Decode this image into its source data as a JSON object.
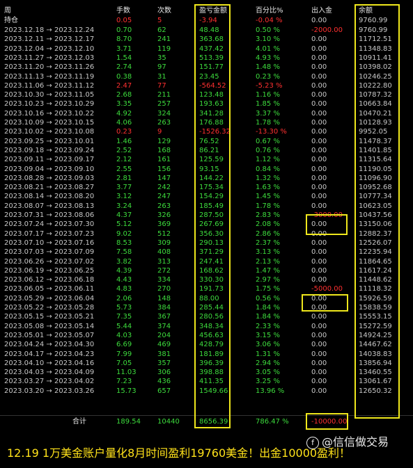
{
  "header": {
    "period": "周",
    "lots": "手数",
    "trades": "次数",
    "pnl": "盈亏金额",
    "pct": "百分比%",
    "flow": "出入金",
    "balance": "余额"
  },
  "open_row": {
    "period": "持仓",
    "lots": "0.05",
    "trades": "5",
    "pnl": "-3.94",
    "pct": "-0.04 %",
    "flow": "0.00",
    "balance": "9760.99"
  },
  "rows": [
    {
      "period": "2023.12.18 → 2023.12.24",
      "lots": "0.70",
      "trades": "62",
      "pnl": "48.48",
      "pct": "0.50 %",
      "flow": "-2000.00",
      "balance": "9760.99"
    },
    {
      "period": "2023.12.11 → 2023.12.17",
      "lots": "8.70",
      "trades": "241",
      "pnl": "363.68",
      "pct": "3.10 %",
      "flow": "0.00",
      "balance": "11712.51"
    },
    {
      "period": "2023.12.04 → 2023.12.10",
      "lots": "3.71",
      "trades": "119",
      "pnl": "437.42",
      "pct": "4.01 %",
      "flow": "0.00",
      "balance": "11348.83"
    },
    {
      "period": "2023.11.27 → 2023.12.03",
      "lots": "1.54",
      "trades": "35",
      "pnl": "513.39",
      "pct": "4.93 %",
      "flow": "0.00",
      "balance": "10911.41"
    },
    {
      "period": "2023.11.20 → 2023.11.26",
      "lots": "2.74",
      "trades": "97",
      "pnl": "151.77",
      "pct": "1.48 %",
      "flow": "0.00",
      "balance": "10398.02"
    },
    {
      "period": "2023.11.13 → 2023.11.19",
      "lots": "0.38",
      "trades": "31",
      "pnl": "23.45",
      "pct": "0.23 %",
      "flow": "0.00",
      "balance": "10246.25"
    },
    {
      "period": "2023.11.06 → 2023.11.12",
      "lots": "2.47",
      "trades": "77",
      "pnl": "-564.52",
      "pct": "-5.23 %",
      "flow": "0.00",
      "balance": "10222.80"
    },
    {
      "period": "2023.10.30 → 2023.11.05",
      "lots": "2.68",
      "trades": "211",
      "pnl": "123.48",
      "pct": "1.16 %",
      "flow": "0.00",
      "balance": "10787.32"
    },
    {
      "period": "2023.10.23 → 2023.10.29",
      "lots": "3.35",
      "trades": "257",
      "pnl": "193.63",
      "pct": "1.85 %",
      "flow": "0.00",
      "balance": "10663.84"
    },
    {
      "period": "2023.10.16 → 2023.10.22",
      "lots": "4.92",
      "trades": "324",
      "pnl": "341.28",
      "pct": "3.37 %",
      "flow": "0.00",
      "balance": "10470.21"
    },
    {
      "period": "2023.10.09 → 2023.10.15",
      "lots": "4.06",
      "trades": "263",
      "pnl": "176.88",
      "pct": "1.78 %",
      "flow": "0.00",
      "balance": "10128.93"
    },
    {
      "period": "2023.10.02 → 2023.10.08",
      "lots": "0.23",
      "trades": "9",
      "pnl": "-1526.32",
      "pct": "-13.30 %",
      "flow": "0.00",
      "balance": "9952.05"
    },
    {
      "period": "2023.09.25 → 2023.10.01",
      "lots": "1.46",
      "trades": "129",
      "pnl": "76.52",
      "pct": "0.67 %",
      "flow": "0.00",
      "balance": "11478.37"
    },
    {
      "period": "2023.09.18 → 2023.09.24",
      "lots": "2.52",
      "trades": "168",
      "pnl": "86.21",
      "pct": "0.76 %",
      "flow": "0.00",
      "balance": "11401.85"
    },
    {
      "period": "2023.09.11 → 2023.09.17",
      "lots": "2.12",
      "trades": "161",
      "pnl": "125.59",
      "pct": "1.12 %",
      "flow": "0.00",
      "balance": "11315.64"
    },
    {
      "period": "2023.09.04 → 2023.09.10",
      "lots": "2.55",
      "trades": "156",
      "pnl": "93.15",
      "pct": "0.84 %",
      "flow": "0.00",
      "balance": "11190.05"
    },
    {
      "period": "2023.08.28 → 2023.09.03",
      "lots": "2.81",
      "trades": "147",
      "pnl": "144.22",
      "pct": "1.32 %",
      "flow": "0.00",
      "balance": "11096.90"
    },
    {
      "period": "2023.08.21 → 2023.08.27",
      "lots": "3.77",
      "trades": "242",
      "pnl": "175.34",
      "pct": "1.63 %",
      "flow": "0.00",
      "balance": "10952.68"
    },
    {
      "period": "2023.08.14 → 2023.08.20",
      "lots": "3.12",
      "trades": "247",
      "pnl": "154.29",
      "pct": "1.45 %",
      "flow": "0.00",
      "balance": "10777.34"
    },
    {
      "period": "2023.08.07 → 2023.08.13",
      "lots": "3.24",
      "trades": "263",
      "pnl": "185.49",
      "pct": "1.78 %",
      "flow": "0.00",
      "balance": "10623.05"
    },
    {
      "period": "2023.07.31 → 2023.08.06",
      "lots": "4.37",
      "trades": "326",
      "pnl": "287.50",
      "pct": "2.83 %",
      "flow": "-3000.00",
      "balance": "10437.56"
    },
    {
      "period": "2023.07.24 → 2023.07.30",
      "lots": "5.12",
      "trades": "369",
      "pnl": "267.69",
      "pct": "2.08 %",
      "flow": "0.00",
      "balance": "13150.06"
    },
    {
      "period": "2023.07.17 → 2023.07.23",
      "lots": "9.02",
      "trades": "512",
      "pnl": "356.30",
      "pct": "2.86 %",
      "flow": "0.00",
      "balance": "12882.37"
    },
    {
      "period": "2023.07.10 → 2023.07.16",
      "lots": "8.53",
      "trades": "309",
      "pnl": "290.13",
      "pct": "2.37 %",
      "flow": "0.00",
      "balance": "12526.07"
    },
    {
      "period": "2023.07.03 → 2023.07.09",
      "lots": "7.58",
      "trades": "408",
      "pnl": "371.29",
      "pct": "3.13 %",
      "flow": "0.00",
      "balance": "12235.94"
    },
    {
      "period": "2023.06.26 → 2023.07.02",
      "lots": "3.82",
      "trades": "313",
      "pnl": "247.41",
      "pct": "2.13 %",
      "flow": "0.00",
      "balance": "11864.65"
    },
    {
      "period": "2023.06.19 → 2023.06.25",
      "lots": "4.39",
      "trades": "272",
      "pnl": "168.62",
      "pct": "1.47 %",
      "flow": "0.00",
      "balance": "11617.24"
    },
    {
      "period": "2023.06.12 → 2023.06.18",
      "lots": "4.43",
      "trades": "334",
      "pnl": "330.30",
      "pct": "2.97 %",
      "flow": "0.00",
      "balance": "11448.62"
    },
    {
      "period": "2023.06.05 → 2023.06.11",
      "lots": "4.83",
      "trades": "270",
      "pnl": "191.73",
      "pct": "1.75 %",
      "flow": "-5000.00",
      "balance": "11118.32"
    },
    {
      "period": "2023.05.29 → 2023.06.04",
      "lots": "2.06",
      "trades": "148",
      "pnl": "88.00",
      "pct": "0.56 %",
      "flow": "0.00",
      "balance": "15926.59"
    },
    {
      "period": "2023.05.22 → 2023.05.28",
      "lots": "5.73",
      "trades": "384",
      "pnl": "285.44",
      "pct": "1.84 %",
      "flow": "0.00",
      "balance": "15838.59"
    },
    {
      "period": "2023.05.15 → 2023.05.21",
      "lots": "7.35",
      "trades": "367",
      "pnl": "280.56",
      "pct": "1.84 %",
      "flow": "0.00",
      "balance": "15553.15"
    },
    {
      "period": "2023.05.08 → 2023.05.14",
      "lots": "5.44",
      "trades": "374",
      "pnl": "348.34",
      "pct": "2.33 %",
      "flow": "0.00",
      "balance": "15272.59"
    },
    {
      "period": "2023.05.01 → 2023.05.07",
      "lots": "4.03",
      "trades": "204",
      "pnl": "456.63",
      "pct": "3.15 %",
      "flow": "0.00",
      "balance": "14924.25"
    },
    {
      "period": "2023.04.24 → 2023.04.30",
      "lots": "6.69",
      "trades": "469",
      "pnl": "428.79",
      "pct": "3.06 %",
      "flow": "0.00",
      "balance": "14467.62"
    },
    {
      "period": "2023.04.17 → 2023.04.23",
      "lots": "7.99",
      "trades": "381",
      "pnl": "181.89",
      "pct": "1.31 %",
      "flow": "0.00",
      "balance": "14038.83"
    },
    {
      "period": "2023.04.10 → 2023.04.16",
      "lots": "7.05",
      "trades": "357",
      "pnl": "396.39",
      "pct": "2.94 %",
      "flow": "0.00",
      "balance": "13856.94"
    },
    {
      "period": "2023.04.03 → 2023.04.09",
      "lots": "11.03",
      "trades": "306",
      "pnl": "398.88",
      "pct": "3.05 %",
      "flow": "0.00",
      "balance": "13460.55"
    },
    {
      "period": "2023.03.27 → 2023.04.02",
      "lots": "7.23",
      "trades": "436",
      "pnl": "411.35",
      "pct": "3.25 %",
      "flow": "0.00",
      "balance": "13061.67"
    },
    {
      "period": "2023.03.20 → 2023.03.26",
      "lots": "15.73",
      "trades": "657",
      "pnl": "1549.66",
      "pct": "13.96 %",
      "flow": "0.00",
      "balance": "12650.32"
    }
  ],
  "total": {
    "label": "合计",
    "lots": "189.54",
    "trades": "10440",
    "pnl": "8656.39",
    "pct": "786.47 %",
    "flow": "-10000.00"
  },
  "caption": "12.19 1万美金账户量化8月时间盈利19760美金！出金10000盈利！",
  "watermark": {
    "logo": "f",
    "text": "@信信做交易"
  },
  "colors": {
    "positive": "#3ddc3d",
    "negative": "#ff3030",
    "neutral": "#c8c8c8",
    "highlight": "#f0e81c",
    "caption": "#ffe21a"
  }
}
